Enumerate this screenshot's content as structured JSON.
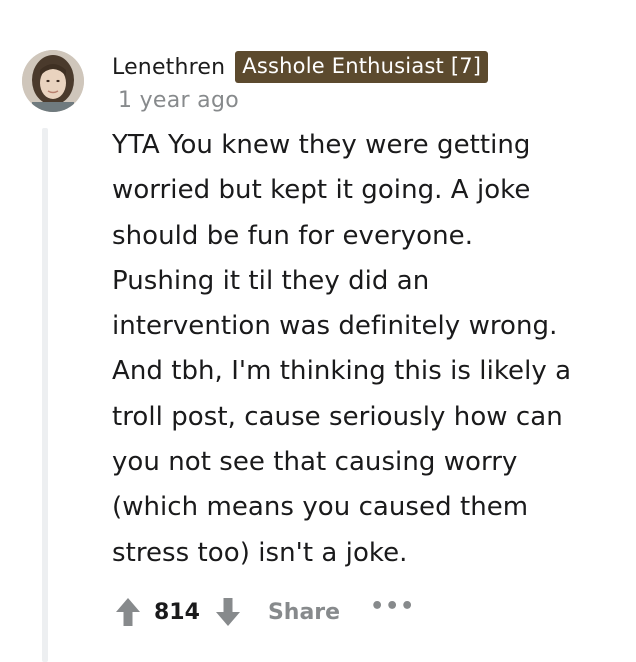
{
  "comment": {
    "author": {
      "username": "Lenethren",
      "flair": "Asshole Enthusiast [7]",
      "avatar_icon": "user-avatar"
    },
    "timestamp": "1 year ago",
    "body_lines": [
      "YTA You knew they were getting",
      "worried but kept it going. A joke",
      "should be fun for everyone.",
      "Pushing it til they did an",
      "intervention was definitely wrong.",
      "And tbh, I'm thinking this is likely a",
      "troll post, cause seriously how can",
      "you not see that causing worry",
      "(which means you caused them",
      "stress too) isn't a joke."
    ],
    "actions": {
      "upvote_icon": "upvote-arrow-icon",
      "score": "814",
      "downvote_icon": "downvote-arrow-icon",
      "share_label": "Share",
      "more_label": "•••"
    }
  },
  "colors": {
    "flair_background": "#5c4a2e",
    "muted_text": "#878a8c",
    "vote_arrow": "#878a8c",
    "thread_line": "#edeff1"
  }
}
